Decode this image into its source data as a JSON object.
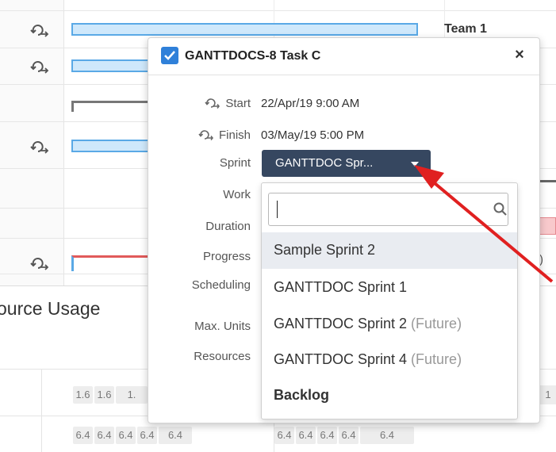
{
  "gantt": {
    "team_label": "Team 1",
    "right_h_text": "h)",
    "right_paren_text": ")"
  },
  "section": {
    "title": "ource Usage"
  },
  "usage": {
    "row1": [
      "1.6",
      "1.6",
      "1."
    ],
    "row1_right": "1",
    "row2_left": [
      "6.4",
      "6.4",
      "6.4",
      "6.4",
      "6.4"
    ],
    "row2_right": [
      "6.4",
      "6.4",
      "6.4",
      "6.4",
      "6.4"
    ]
  },
  "popup": {
    "title": "GANTTDOCS-8 Task C",
    "close_label": "×",
    "fields": {
      "start_label": "Start",
      "start_value": "22/Apr/19 9:00 AM",
      "finish_label": "Finish",
      "finish_value": "03/May/19 5:00 PM",
      "sprint_label": "Sprint",
      "sprint_value": "GANTTDOC Spr...",
      "work_label": "Work",
      "duration_label": "Duration",
      "progress_label": "Progress",
      "scheduling_label": "Scheduling",
      "max_units_label": "Max. Units",
      "resources_label": "Resources"
    }
  },
  "dropdown": {
    "search_value": "",
    "options": [
      {
        "label": "Sample Sprint 2",
        "suffix": ""
      },
      {
        "label": "GANTTDOC Sprint 1",
        "suffix": ""
      },
      {
        "label": "GANTTDOC Sprint 2",
        "suffix": "(Future)"
      },
      {
        "label": "GANTTDOC Sprint 4",
        "suffix": "(Future)"
      },
      {
        "label": "Backlog",
        "suffix": ""
      }
    ]
  },
  "colors": {
    "accent": "#2f80d9",
    "sprint_button": "#364760",
    "arrow": "#e02020"
  }
}
